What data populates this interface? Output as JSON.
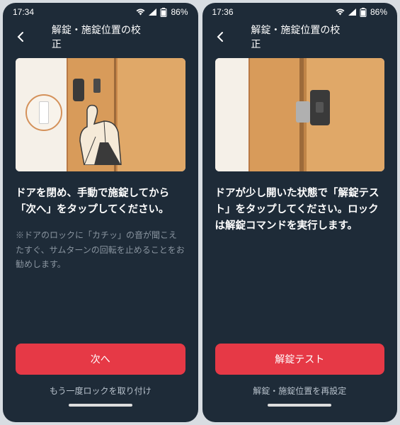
{
  "screens": [
    {
      "status": {
        "time": "17:34",
        "battery": "86%"
      },
      "header": {
        "title": "解錠・施錠位置の校正"
      },
      "main_text": "ドアを閉め、手動で施錠してから「次へ」をタップしてください。",
      "sub_text": "※ドアのロックに「カチッ」の音が聞こえたすぐ、サムターンの回転を止めることをお勧めします。",
      "primary_button": "次へ",
      "secondary_link": "もう一度ロックを取り付け"
    },
    {
      "status": {
        "time": "17:36",
        "battery": "86%"
      },
      "header": {
        "title": "解錠・施錠位置の校正"
      },
      "main_text": "ドアが少し開いた状態で「解錠テスト」をタップしてください。ロックは解錠コマンドを実行します。",
      "sub_text": "",
      "primary_button": "解錠テスト",
      "secondary_link": "解錠・施錠位置を再設定"
    }
  ]
}
